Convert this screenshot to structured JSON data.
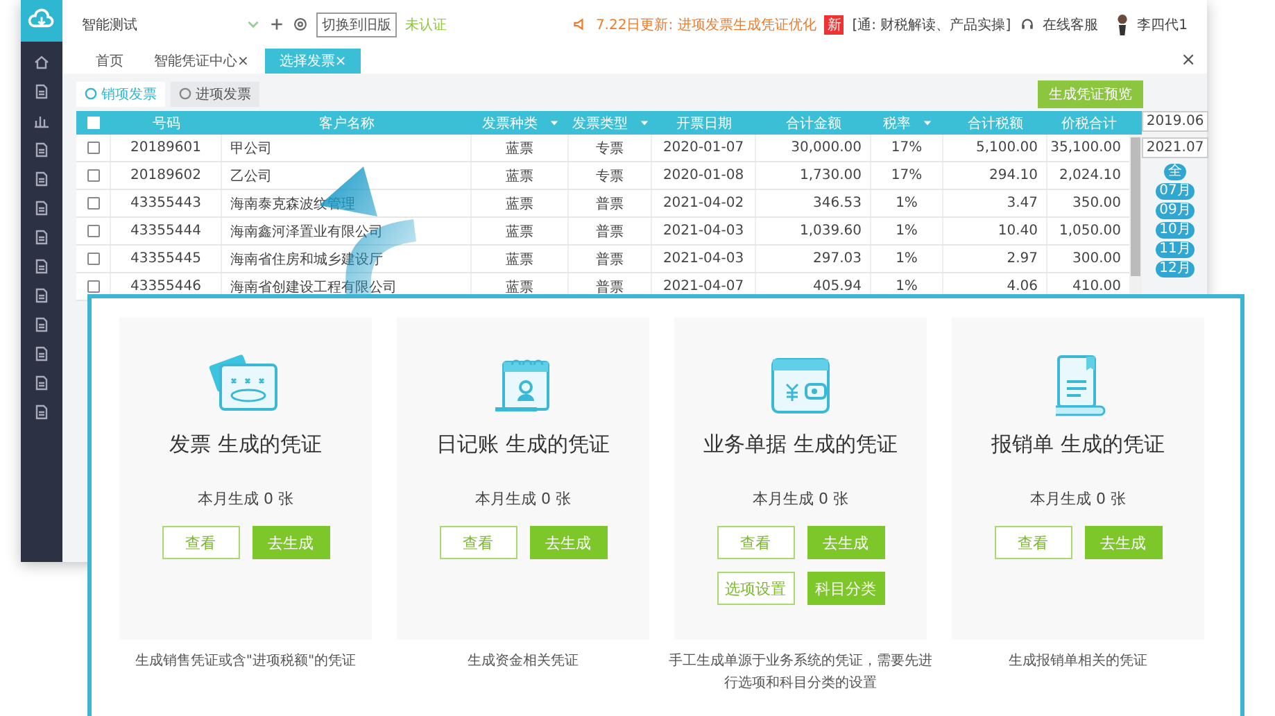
{
  "topbar": {
    "company": "智能测试",
    "switch_button": "切换到旧版",
    "cert_status": "未认证",
    "notice": "7.22日更新: 进项发票生成凭证优化",
    "badge": "新",
    "live": "[通: 财税解读、产品实操]",
    "service": "在线客服",
    "user": "李四代1"
  },
  "tabs": [
    {
      "label": "首页",
      "selected": false
    },
    {
      "label": "智能凭证中心",
      "close": "×",
      "selected": false
    },
    {
      "label": "选择发票",
      "close": "×",
      "selected": true
    }
  ],
  "window_close": "×",
  "subtabs": [
    {
      "label": "销项发票",
      "selected": true
    },
    {
      "label": "进项发票",
      "selected": false
    }
  ],
  "preview_button": "生成凭证预览",
  "table": {
    "all_checked": false,
    "columns": [
      {
        "label": "号码",
        "sortable": false
      },
      {
        "label": "客户名称",
        "sortable": false
      },
      {
        "label": "发票种类",
        "sortable": true
      },
      {
        "label": "发票类型",
        "sortable": true
      },
      {
        "label": "开票日期",
        "sortable": false
      },
      {
        "label": "合计金额",
        "sortable": false
      },
      {
        "label": "税率",
        "sortable": true
      },
      {
        "label": "合计税额",
        "sortable": false
      },
      {
        "label": "价税合计",
        "sortable": false
      }
    ],
    "rows": [
      {
        "checked": false,
        "cells": [
          "20189601",
          "甲公司",
          "蓝票",
          "专票",
          "2020-01-07",
          "30,000.00",
          "17%",
          "5,100.00",
          "35,100.00"
        ]
      },
      {
        "checked": false,
        "cells": [
          "20189602",
          "乙公司",
          "蓝票",
          "专票",
          "2020-01-08",
          "1,730.00",
          "17%",
          "294.10",
          "2,024.10"
        ]
      },
      {
        "checked": false,
        "cells": [
          "43355443",
          "海南泰克森波纹管理",
          "蓝票",
          "普票",
          "2021-04-02",
          "346.53",
          "1%",
          "3.47",
          "350.00"
        ]
      },
      {
        "checked": false,
        "cells": [
          "43355444",
          "海南鑫河泽置业有限公司",
          "蓝票",
          "普票",
          "2021-04-03",
          "1,039.60",
          "1%",
          "10.40",
          "1,050.00"
        ]
      },
      {
        "checked": false,
        "cells": [
          "43355445",
          "海南省住房和城乡建设厅",
          "蓝票",
          "普票",
          "2021-04-03",
          "297.03",
          "1%",
          "2.97",
          "300.00"
        ]
      },
      {
        "checked": false,
        "cells": [
          "43355446",
          "海南省创建设工程有限公司",
          "蓝票",
          "普票",
          "2021-04-07",
          "405.94",
          "1%",
          "4.06",
          "410.00"
        ]
      }
    ]
  },
  "period": {
    "from": "2019.06",
    "to": "2021.07",
    "months": [
      "全",
      "07月",
      "09月",
      "10月",
      "11月",
      "12月"
    ]
  },
  "cards": [
    {
      "kind": "invoice",
      "title": "发票 生成的凭证",
      "count": "本月生成 0 张",
      "buttons": [
        {
          "label": "查看",
          "kind": "outline"
        },
        {
          "label": "去生成",
          "kind": "fill"
        }
      ],
      "note": "生成销售凭证或含\"进项税额\"的凭证"
    },
    {
      "kind": "journal",
      "title": "日记账 生成的凭证",
      "count": "本月生成 0 张",
      "buttons": [
        {
          "label": "查看",
          "kind": "outline"
        },
        {
          "label": "去生成",
          "kind": "fill"
        }
      ],
      "note": "生成资金相关凭证"
    },
    {
      "kind": "wallet",
      "title": "业务单据 生成的凭证",
      "count": "本月生成 0 张",
      "buttons": [
        {
          "label": "查看",
          "kind": "outline"
        },
        {
          "label": "去生成",
          "kind": "fill"
        },
        {
          "label": "选项设置",
          "kind": "outline"
        },
        {
          "label": "科目分类",
          "kind": "fill"
        }
      ],
      "note": "手工生成单源于业务系统的凭证，需要先进行选项和科目分类的设置"
    },
    {
      "kind": "receipt",
      "title": "报销单 生成的凭证",
      "count": "本月生成 0 张",
      "buttons": [
        {
          "label": "查看",
          "kind": "outline"
        },
        {
          "label": "去生成",
          "kind": "fill"
        }
      ],
      "note": "生成报销单相关的凭证"
    }
  ]
}
